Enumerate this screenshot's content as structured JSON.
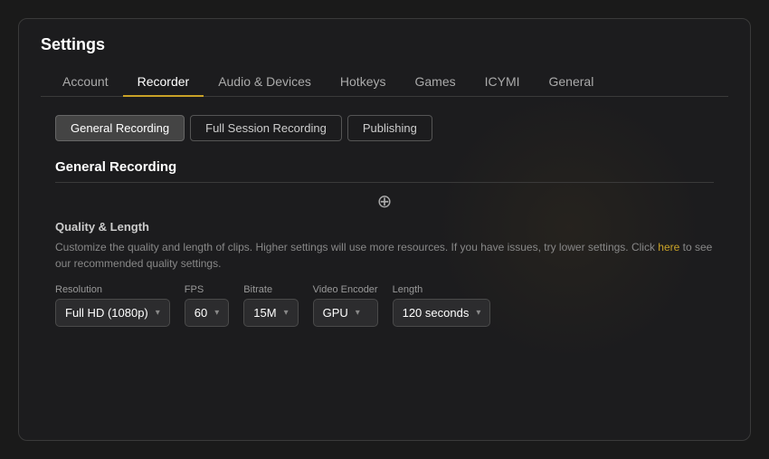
{
  "window": {
    "title": "Settings"
  },
  "nav": {
    "tabs": [
      {
        "id": "account",
        "label": "Account",
        "active": false
      },
      {
        "id": "recorder",
        "label": "Recorder",
        "active": true
      },
      {
        "id": "audio-devices",
        "label": "Audio & Devices",
        "active": false
      },
      {
        "id": "hotkeys",
        "label": "Hotkeys",
        "active": false
      },
      {
        "id": "games",
        "label": "Games",
        "active": false
      },
      {
        "id": "icymi",
        "label": "ICYMI",
        "active": false
      },
      {
        "id": "general",
        "label": "General",
        "active": false
      }
    ]
  },
  "sub_tabs": [
    {
      "id": "general-recording",
      "label": "General Recording",
      "active": true
    },
    {
      "id": "full-session",
      "label": "Full Session Recording",
      "active": false
    },
    {
      "id": "publishing",
      "label": "Publishing",
      "active": false
    }
  ],
  "section": {
    "title": "General Recording"
  },
  "quality_group": {
    "label": "Quality & Length",
    "description_part1": "Customize the quality and length of clips. Higher settings will use more resources. If you have issues, try lower settings. Click ",
    "link_text": "here",
    "description_part2": " to see our recommended quality settings."
  },
  "dropdowns": [
    {
      "id": "resolution",
      "label": "Resolution",
      "value": "Full HD (1080p)",
      "show_arrow": true
    },
    {
      "id": "fps",
      "label": "FPS",
      "value": "60",
      "show_arrow": true
    },
    {
      "id": "bitrate",
      "label": "Bitrate",
      "value": "15M",
      "show_arrow": true
    },
    {
      "id": "video-encoder",
      "label": "Video Encoder",
      "value": "GPU",
      "show_arrow": true
    },
    {
      "id": "length",
      "label": "Length",
      "value": "120 seconds",
      "show_arrow": true
    }
  ],
  "icons": {
    "chevron": "▾",
    "move": "⊕"
  }
}
